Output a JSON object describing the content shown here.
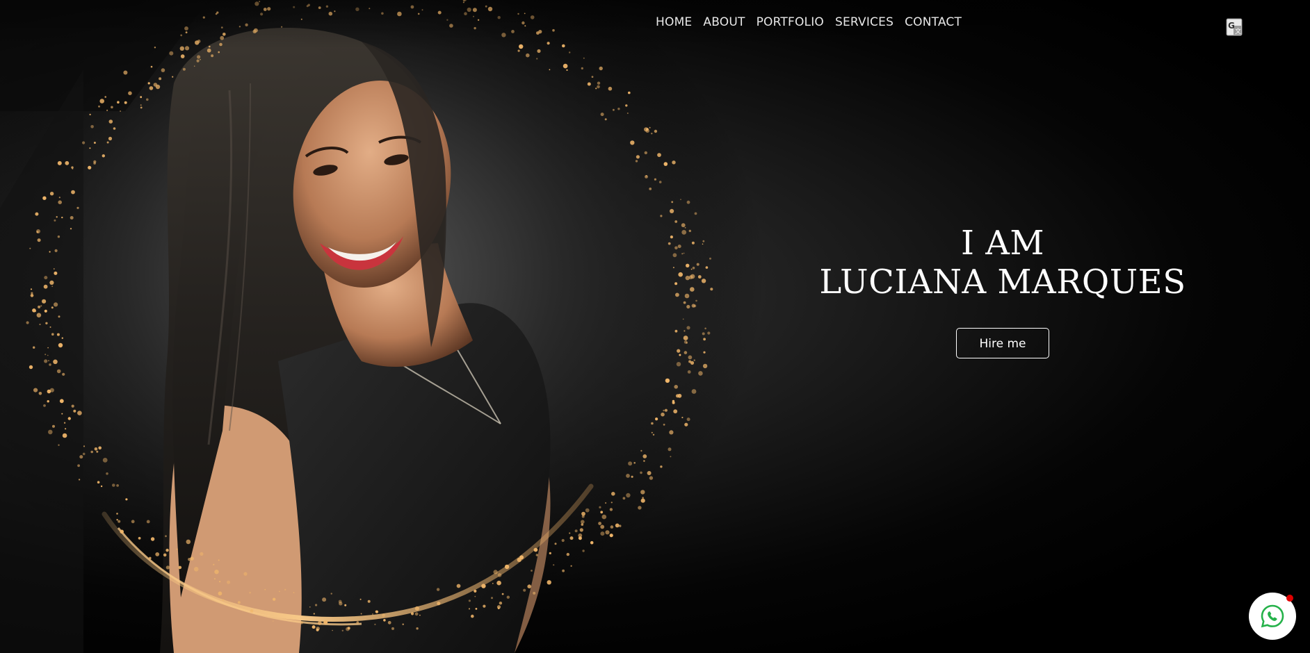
{
  "nav": {
    "items": [
      {
        "label": "HOME"
      },
      {
        "label": "ABOUT"
      },
      {
        "label": "PORTFOLIO"
      },
      {
        "label": "SERVICES"
      },
      {
        "label": "CONTACT"
      }
    ],
    "translate_icon": "google-translate-icon"
  },
  "hero": {
    "line1": "I AM",
    "line2": "LUCIANA MARQUES",
    "cta_label": "Hire me",
    "photo_icon": "portrait-photo",
    "sparkle_color": "#f0b66a"
  },
  "floating": {
    "whatsapp_icon": "whatsapp-icon",
    "notification_color": "#e00000",
    "whatsapp_color": "#25b24a"
  }
}
